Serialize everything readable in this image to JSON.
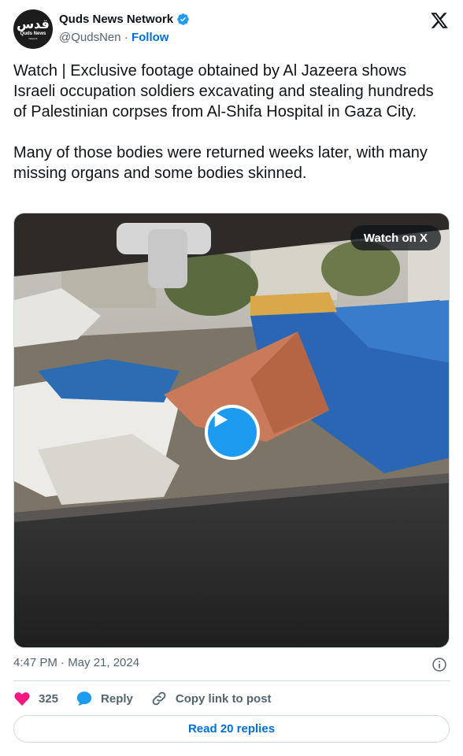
{
  "author": {
    "display_name": "Quds News Network",
    "handle": "@QudsNen",
    "separator": "·",
    "follow_label": "Follow",
    "avatar_arabic": "قدس",
    "avatar_english": "Quds News",
    "avatar_sub": "Network"
  },
  "tweet": {
    "paragraph1": "Watch | Exclusive footage obtained by Al Jazeera shows Israeli occupation soldiers excavating and stealing hundreds of Palestinian corpses from Al-Shifa Hospital in Gaza City.",
    "paragraph2": "Many of those bodies were returned weeks later, with many missing organs and some bodies skinned."
  },
  "media": {
    "watch_label": "Watch on X"
  },
  "meta": {
    "timestamp": "4:47 PM · May 21, 2024"
  },
  "actions": {
    "like_count": "325",
    "reply_label": "Reply",
    "copy_label": "Copy link to post"
  },
  "footer": {
    "read_replies_label": "Read 20 replies"
  },
  "colors": {
    "accent": "#1d9bf0",
    "link": "#006fd6",
    "like": "#f91880",
    "muted": "#536471"
  },
  "icons": [
    "verified-badge-icon",
    "x-logo-icon",
    "play-icon",
    "info-icon",
    "heart-icon",
    "reply-icon",
    "link-icon"
  ]
}
